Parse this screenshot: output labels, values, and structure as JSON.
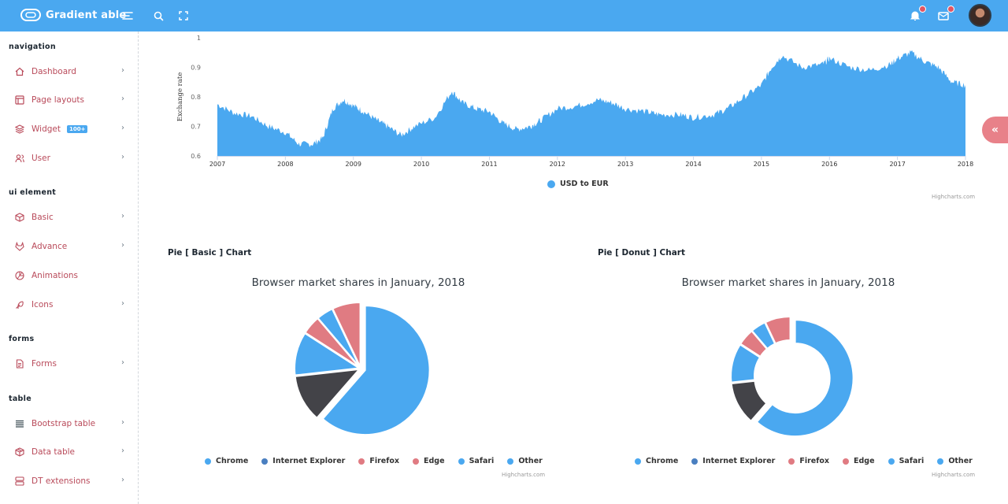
{
  "brand": {
    "name": "Gradient able"
  },
  "sidebar": {
    "sections": [
      {
        "caption": "navigation",
        "items": [
          {
            "label": "Dashboard",
            "icon": "home-icon",
            "chevron": true
          },
          {
            "label": "Page layouts",
            "icon": "layout-icon",
            "chevron": true
          },
          {
            "label": "Widget",
            "icon": "layers-icon",
            "chevron": true,
            "badge": "100+"
          },
          {
            "label": "User",
            "icon": "users-icon",
            "chevron": true
          }
        ]
      },
      {
        "caption": "ui element",
        "items": [
          {
            "label": "Basic",
            "icon": "box-icon",
            "chevron": true
          },
          {
            "label": "Advance",
            "icon": "gitlab-icon",
            "chevron": true
          },
          {
            "label": "Animations",
            "icon": "aperture-icon",
            "chevron": false
          },
          {
            "label": "Icons",
            "icon": "feather-icon",
            "chevron": true
          }
        ]
      },
      {
        "caption": "forms",
        "items": [
          {
            "label": "Forms",
            "icon": "file-text-icon",
            "chevron": true
          }
        ]
      },
      {
        "caption": "table",
        "items": [
          {
            "label": "Bootstrap table",
            "icon": "align-justify-icon",
            "chevron": true
          },
          {
            "label": "Data table",
            "icon": "package-icon",
            "chevron": true
          },
          {
            "label": "DT extensions",
            "icon": "server-icon",
            "chevron": true
          }
        ]
      }
    ]
  },
  "colors": {
    "accent": "#4aa8f0",
    "dark": "#434348",
    "pink": "#e07b82",
    "topbar": "#4aa8f0"
  },
  "area_chart": {
    "chart_data": {
      "type": "area",
      "ylabel": "Exchange rate",
      "yticks": [
        "1",
        "0.9",
        "0.8",
        "0.7",
        "0.6"
      ],
      "ylim": [
        0.6,
        1
      ],
      "xticks": [
        "2007",
        "2008",
        "2009",
        "2010",
        "2011",
        "2012",
        "2013",
        "2014",
        "2015",
        "2016",
        "2017",
        "2018"
      ],
      "series": [
        {
          "name": "USD to EUR",
          "x": [
            2007.0,
            2007.25,
            2007.5,
            2007.75,
            2008.0,
            2008.2,
            2008.4,
            2008.55,
            2008.7,
            2008.85,
            2009.0,
            2009.15,
            2009.35,
            2009.5,
            2009.7,
            2009.9,
            2010.2,
            2010.45,
            2010.6,
            2010.8,
            2011.0,
            2011.2,
            2011.4,
            2011.6,
            2011.75,
            2012.0,
            2012.3,
            2012.6,
            2012.8,
            2013.0,
            2013.3,
            2013.5,
            2013.8,
            2014.0,
            2014.3,
            2014.5,
            2014.75,
            2015.0,
            2015.15,
            2015.3,
            2015.6,
            2015.9,
            2016.0,
            2016.3,
            2016.6,
            2016.9,
            2017.0,
            2017.2,
            2017.4,
            2017.6,
            2017.8,
            2018.0
          ],
          "y": [
            0.775,
            0.745,
            0.735,
            0.7,
            0.68,
            0.64,
            0.64,
            0.66,
            0.76,
            0.79,
            0.77,
            0.75,
            0.72,
            0.7,
            0.67,
            0.7,
            0.73,
            0.82,
            0.78,
            0.76,
            0.75,
            0.71,
            0.69,
            0.7,
            0.72,
            0.76,
            0.77,
            0.79,
            0.78,
            0.76,
            0.75,
            0.74,
            0.74,
            0.73,
            0.74,
            0.76,
            0.8,
            0.84,
            0.9,
            0.94,
            0.9,
            0.91,
            0.93,
            0.9,
            0.89,
            0.91,
            0.93,
            0.95,
            0.92,
            0.9,
            0.85,
            0.84
          ]
        }
      ],
      "legend_position": "bottom-center"
    }
  },
  "pies": [
    {
      "card_title": "Pie [ Basic ] Chart",
      "chart_data": {
        "type": "pie",
        "title": "Browser market shares in January, 2018",
        "series": [
          {
            "name": "Chrome",
            "value": 61.41
          },
          {
            "name": "Internet Explorer",
            "value": 11.84
          },
          {
            "name": "Firefox",
            "value": 10.85
          },
          {
            "name": "Edge",
            "value": 4.67
          },
          {
            "name": "Safari",
            "value": 4.18
          },
          {
            "name": "Other",
            "value": 7.05
          }
        ]
      }
    },
    {
      "card_title": "Pie [ Donut ] Chart",
      "chart_data": {
        "type": "pie",
        "title": "Browser market shares in January, 2018",
        "series": [
          {
            "name": "Chrome",
            "value": 61.41
          },
          {
            "name": "Internet Explorer",
            "value": 11.84
          },
          {
            "name": "Firefox",
            "value": 10.85
          },
          {
            "name": "Edge",
            "value": 4.67
          },
          {
            "name": "Safari",
            "value": 4.18
          },
          {
            "name": "Other",
            "value": 7.05
          }
        ]
      }
    }
  ],
  "legend_colors": [
    "#4aa8f0",
    "#434348",
    "#4aa8f0",
    "#e07b82",
    "#e07b82",
    "#4aa8f0",
    "#4aa8f0"
  ],
  "credit": "Highcharts.com"
}
